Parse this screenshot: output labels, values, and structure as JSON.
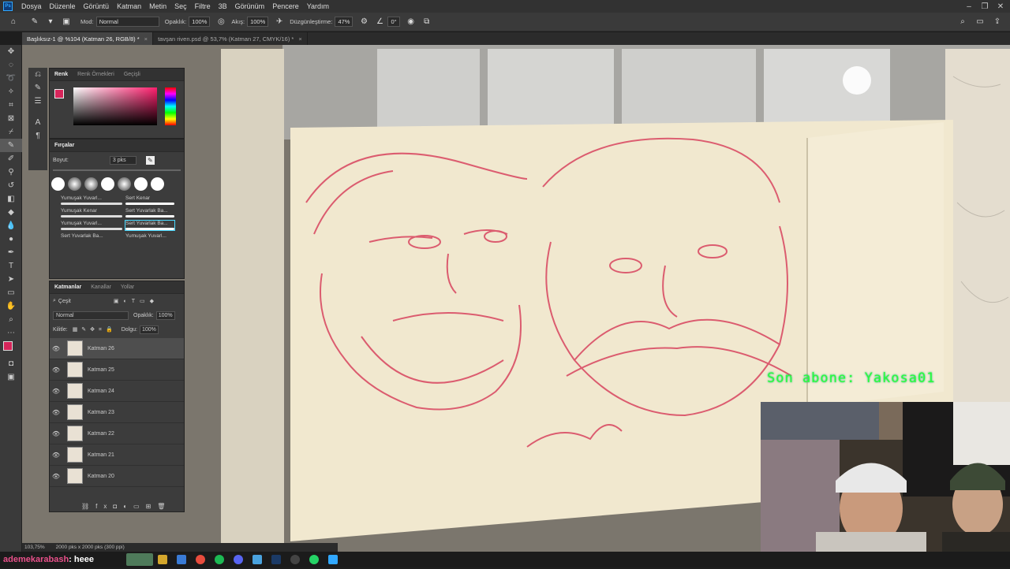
{
  "app": {
    "logo": "Ps"
  },
  "menu": [
    "Dosya",
    "Düzenle",
    "Görüntü",
    "Katman",
    "Metin",
    "Seç",
    "Filtre",
    "3B",
    "Görünüm",
    "Pencere",
    "Yardım"
  ],
  "options": {
    "mode_label": "Mod:",
    "mode_value": "Normal",
    "opacity_label": "Opaklık:",
    "opacity_value": "100%",
    "flow_label": "Akış:",
    "flow_value": "100%",
    "smoothing_label": "Düzgünleştirme:",
    "smoothing_value": "47%",
    "angle_value": "0°"
  },
  "tabs": [
    {
      "label": "Başlıksız-1 @ %104 (Katman 26, RGB/8) *",
      "active": true
    },
    {
      "label": "tavşan riven.psd @ 53,7% (Katman 27, CMYK/16) *",
      "active": false
    }
  ],
  "color_panel": {
    "tabs": [
      "Renk",
      "Renk Örnekleri",
      "Geçişli"
    ],
    "fg_color": "#d6255a",
    "bg_color": "#f2b2a0"
  },
  "brush_panel": {
    "title": "Fırçalar",
    "size_label": "Boyut:",
    "size_value": "3 pks",
    "presets": [
      {
        "name": "Yumuşak Yuvarl..."
      },
      {
        "name": "Sert Kenar"
      },
      {
        "name": "Yumuşak Kenar"
      },
      {
        "name": "Sert Yuvarlak Ba..."
      },
      {
        "name": "Yumuşak Yuvarl..."
      },
      {
        "name": "Sert Yuvarlak Ba..."
      },
      {
        "name": "Sert Yuvarlak Ba..."
      },
      {
        "name": "Yumuşak Yuvarl..."
      }
    ]
  },
  "layers_panel": {
    "tabs": [
      "Katmanlar",
      "Kanallar",
      "Yollar"
    ],
    "filter_label": "Çeşit",
    "blend_mode": "Normal",
    "opacity_label": "Opaklık:",
    "opacity_value": "100%",
    "lock_label": "Kilitle:",
    "fill_label": "Dolgu:",
    "fill_value": "100%",
    "layers": [
      {
        "name": "Katman 26",
        "selected": true
      },
      {
        "name": "Katman 25",
        "selected": false
      },
      {
        "name": "Katman 24",
        "selected": false
      },
      {
        "name": "Katman 23",
        "selected": false
      },
      {
        "name": "Katman 22",
        "selected": false
      },
      {
        "name": "Katman 21",
        "selected": false
      },
      {
        "name": "Katman 20",
        "selected": false
      }
    ]
  },
  "status": {
    "zoom": "103,75%",
    "doc_info": "2000 pks x 2000 pks (300 ppi)"
  },
  "overlay": {
    "text": "Son abone: Yakosa01"
  },
  "chat": {
    "user": "ademekarabash",
    "message": ": heee"
  },
  "colors": {
    "accent_green": "#27ff3a",
    "sketch_red": "#d8445f",
    "paper": "#f1e8cf",
    "chat_user": "#e8508a"
  }
}
